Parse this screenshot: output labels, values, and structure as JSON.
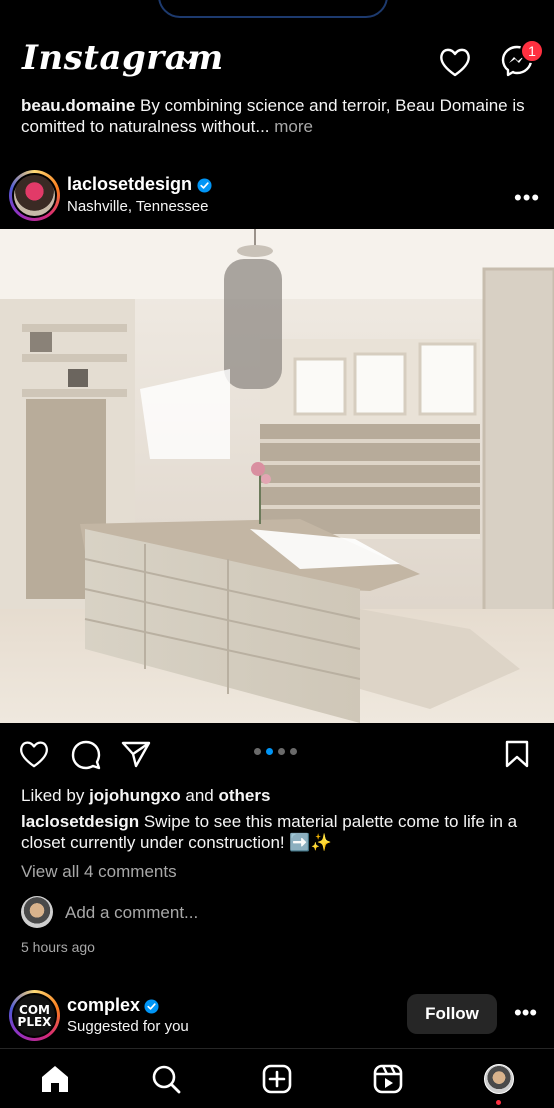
{
  "app": {
    "name": "Instagram",
    "notification_count": "1"
  },
  "previous_post": {
    "username": "beau.domaine",
    "caption": "By combining science and terroir, Beau Domaine is comitted to naturalness without...",
    "more_label": "more"
  },
  "post": {
    "username": "laclosetdesign",
    "location": "Nashville, Tennessee",
    "liked_by_prefix": "Liked by",
    "liked_by_user": "jojohungxo",
    "liked_by_and": "and",
    "liked_by_others": "others",
    "caption": "Swipe to see this material palette come to life in a closet currently under construction! ➡️✨",
    "view_comments": "View all 4 comments",
    "add_comment_placeholder": "Add a comment...",
    "time_ago": "5 hours ago",
    "carousel_count": 4,
    "carousel_active_index": 1
  },
  "suggested": {
    "username": "complex",
    "logo_text": "COM PLEX",
    "subtitle": "Suggested for you",
    "follow_label": "Follow"
  },
  "icons": {
    "top": [
      "chevron-down-icon",
      "heart-icon",
      "messenger-icon"
    ],
    "actions": [
      "heart-icon",
      "comment-icon",
      "share-icon",
      "bookmark-icon"
    ],
    "nav": [
      "home-icon",
      "search-icon",
      "create-icon",
      "reels-icon",
      "profile-avatar"
    ]
  },
  "colors": {
    "background": "#000000",
    "text": "#f5f5f5",
    "muted": "#a8a8a8",
    "accent": "#0095f6",
    "badge": "#ff3040",
    "button": "#262626"
  }
}
